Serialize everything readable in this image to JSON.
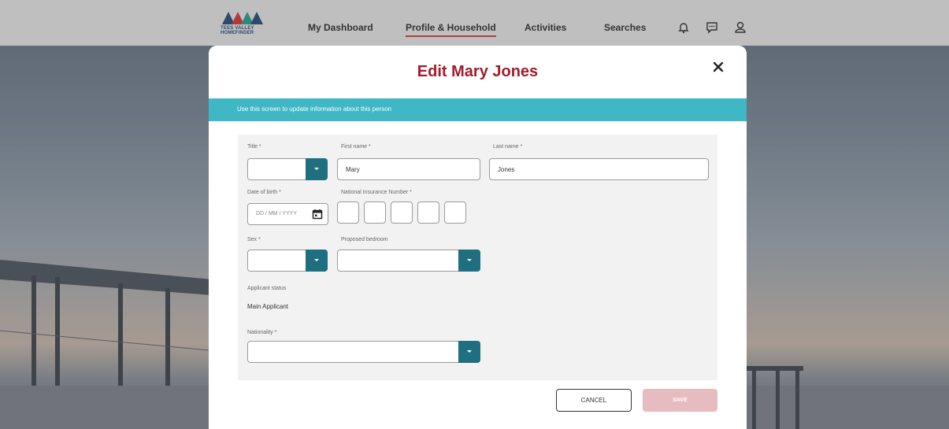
{
  "nav": {
    "logo_text_line1": "TEES VALLEY",
    "logo_text_line2": "HOMEFINDER",
    "links": [
      "My Dashboard",
      "Profile & Household",
      "Activities",
      "Searches"
    ],
    "active_link": "Profile & Household",
    "icons": [
      "bell-icon",
      "message-icon",
      "user-icon"
    ]
  },
  "modal": {
    "title": "Edit Mary Jones",
    "info_text": "Use this screen to update information about this person",
    "form": {
      "title_label": "Title *",
      "title_value": "",
      "first_name_label": "First name *",
      "first_name_value": "Mary",
      "last_name_label": "Last name *",
      "last_name_value": "Jones",
      "dob_label": "Date of birth *",
      "dob_placeholder": "DD / MM / YYYY",
      "ni_label": "National Insurance Number *",
      "sex_label": "Sex *",
      "sex_value": "",
      "bedroom_label": "Proposed bedroom",
      "bedroom_value": "",
      "status_label": "Applicant status",
      "status_value": "Main Applicant",
      "nationality_label": "Nationality *",
      "nationality_value": ""
    },
    "buttons": {
      "cancel": "CANCEL",
      "save": "SAVE"
    }
  },
  "colors": {
    "accent_title": "#a11c2c",
    "info_bar": "#3fb7c4",
    "select_button": "#1f6f80",
    "save_disabled": "#e6bcc0"
  }
}
